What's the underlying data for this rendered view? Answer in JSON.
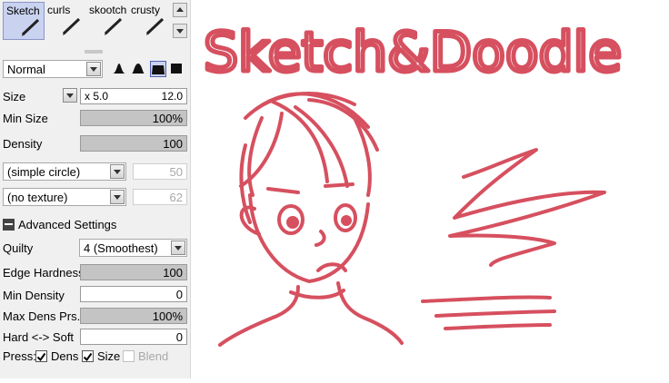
{
  "brushes": [
    {
      "name": "Sketch",
      "selected": true
    },
    {
      "name": "curls",
      "selected": false
    },
    {
      "name": "skootch",
      "selected": false
    },
    {
      "name": "crusty",
      "selected": false
    }
  ],
  "blend_mode": "Normal",
  "size": {
    "label": "Size",
    "multiplier": "x 5.0",
    "value": "12.0"
  },
  "min_size": {
    "label": "Min Size",
    "value": "100%",
    "level": 1.0
  },
  "density": {
    "label": "Density",
    "value": "100",
    "level": 1.0
  },
  "shape_select": {
    "value": "(simple circle)",
    "amount": "50"
  },
  "texture_select": {
    "value": "(no texture)",
    "amount": "62"
  },
  "advanced": {
    "label": "Advanced Settings"
  },
  "quality": {
    "label": "Quilty",
    "value": "4 (Smoothest)"
  },
  "edge_hardness": {
    "label": "Edge Hardness",
    "value": "100",
    "level": 1.0
  },
  "min_density": {
    "label": "Min Density",
    "value": "0",
    "level": 0
  },
  "max_dens_prs": {
    "label": "Max Dens Prs.",
    "value": "100%",
    "level": 1.0
  },
  "hard_soft": {
    "label": "Hard <-> Soft",
    "value": "0",
    "level": 0
  },
  "press": {
    "label": "Press:",
    "dens": {
      "label": "Dens",
      "checked": true
    },
    "size": {
      "label": "Size",
      "checked": true
    },
    "blend": {
      "label": "Blend",
      "checked": false
    }
  },
  "canvas": {
    "title": "Sketch&Doodle"
  },
  "colors": {
    "ink": "#d6505f",
    "panel": "#f0f0f0",
    "selection": "#c9d2ef"
  }
}
